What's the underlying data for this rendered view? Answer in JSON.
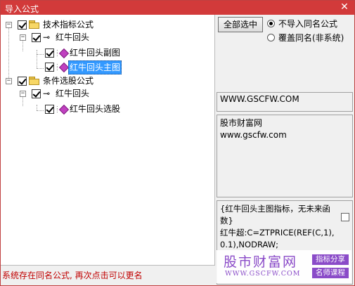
{
  "window": {
    "title": "导入公式",
    "close_glyph": "✕"
  },
  "tree": {
    "group1": {
      "label": "技术指标公式",
      "expander": "−"
    },
    "group1_item": {
      "label": "红牛回头",
      "expander": "−",
      "icon": "key-icon"
    },
    "group1_sub1": {
      "label": "红牛回头副图"
    },
    "group1_sub2": {
      "label": "红牛回头主图",
      "selected": true
    },
    "group2": {
      "label": "条件选股公式",
      "expander": "−"
    },
    "group2_item": {
      "label": "红牛回头",
      "expander": "−",
      "icon": "key-icon"
    },
    "group2_sub1": {
      "label": "红牛回头选股"
    }
  },
  "toolbar": {
    "select_all_label": "全部选中"
  },
  "options": {
    "no_import_same_name": "不导入同名公式",
    "overwrite_same_name": "覆盖同名(非系统)",
    "selected": "no_import_same_name"
  },
  "url_box": {
    "text": "WWW.GSCFW.COM"
  },
  "desc_box": {
    "line1": "股市财富网",
    "line2": "www.gscfw.com"
  },
  "formula_box": {
    "text": "{红牛回头主图指标，无未来函数}\n红牛超:C=ZTPRICE(REF(C,1),0.1),NODRAW;"
  },
  "status": {
    "text": "系统存在同名公式, 再次点击可以更名"
  },
  "watermark": {
    "name": "股市财富网",
    "url": "WWW.GSCFW.COM",
    "tag1": "指标分享",
    "tag2": "名师课程",
    "color": "#8a4bc8"
  },
  "colors": {
    "titlebar": "#d23a3a",
    "selection": "#3399ff",
    "status": "#c00000"
  }
}
